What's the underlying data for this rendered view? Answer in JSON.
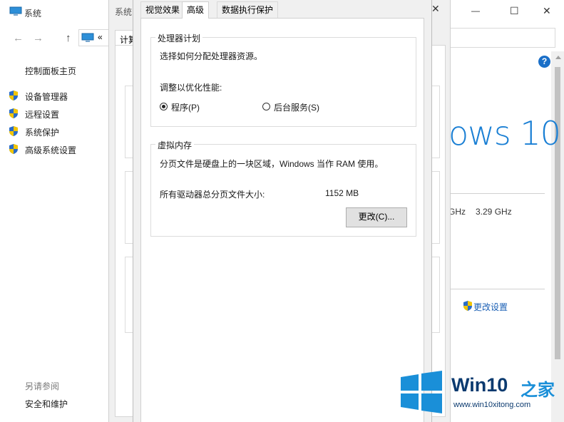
{
  "system_window": {
    "title": "系统",
    "nav_back": "←",
    "nav_forward": "→",
    "nav_up": "↑",
    "breadcrumb_chevron": "«",
    "sidebar": {
      "home": "控制面板主页",
      "items": [
        {
          "label": "设备管理器"
        },
        {
          "label": "远程设置"
        },
        {
          "label": "系统保护"
        },
        {
          "label": "高级系统设置"
        }
      ],
      "see_also_title": "另请参阅",
      "see_also_items": [
        {
          "label": "安全和维护"
        }
      ]
    }
  },
  "background_window": {
    "title": "系统",
    "tab_partial": "计算",
    "logo_text": "ows 10",
    "cpu_speed_1": "GHz",
    "cpu_speed_2": "3.29 GHz",
    "change_settings": "更改设置",
    "help": "?",
    "minimize": "—",
    "maximize": "☐",
    "close": "✕",
    "brand_color": "#1a7fd4"
  },
  "perf_dialog": {
    "close": "✕",
    "tabs": [
      {
        "label": "视觉效果"
      },
      {
        "label": "高级"
      },
      {
        "label": "数据执行保护"
      }
    ],
    "processor": {
      "title": "处理器计划",
      "description": "选择如何分配处理器资源。",
      "optimize_label": "调整以优化性能:",
      "option_programs": "程序(P)",
      "option_services": "后台服务(S)"
    },
    "virtual_memory": {
      "title": "虚拟内存",
      "description": "分页文件是硬盘上的一块区域，Windows 当作 RAM 使用。",
      "total_label": "所有驱动器总分页文件大小:",
      "total_value": "1152 MB",
      "change_button": "更改(C)..."
    }
  },
  "watermark": {
    "brand": "Win10",
    "suffix": "之家",
    "url": "www.win10xitong.com",
    "colors": {
      "blue": "#1a8fd8",
      "dark": "#0b3a6f"
    }
  }
}
